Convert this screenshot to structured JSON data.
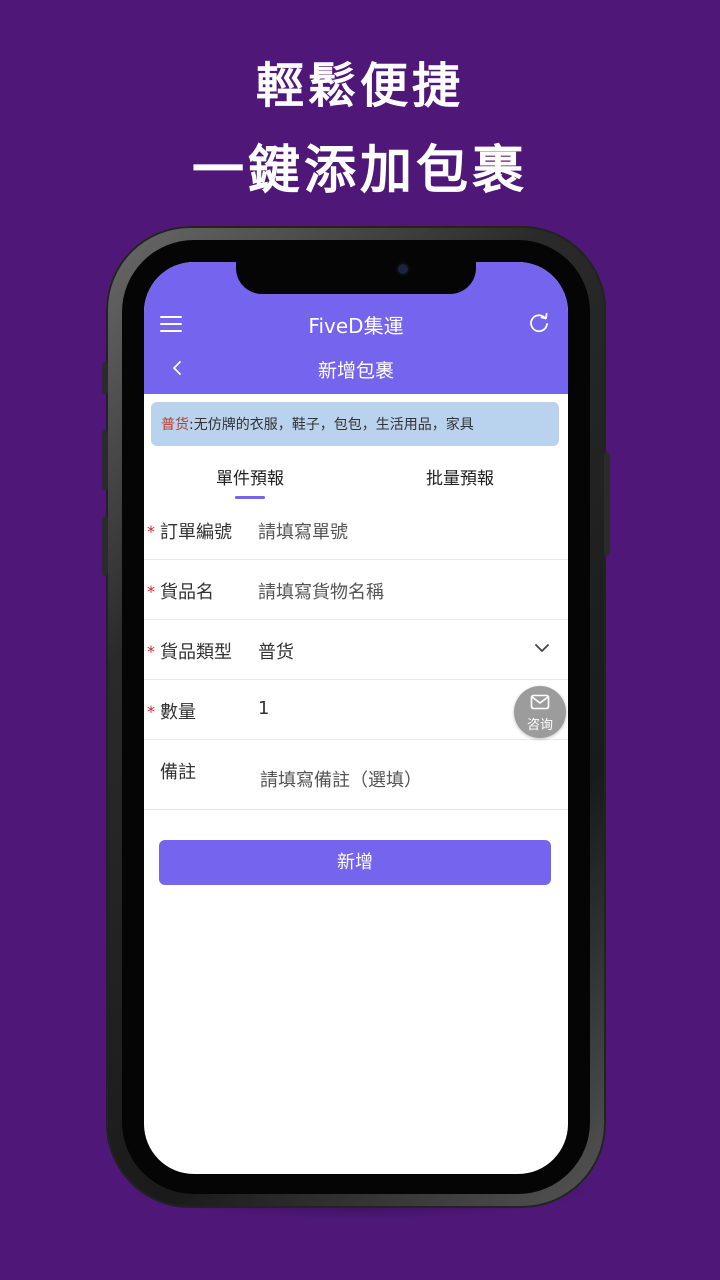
{
  "headline": {
    "line1": "輕鬆便捷",
    "line2": "一鍵添加包裹"
  },
  "app": {
    "title": "FiveD集運",
    "page_title": "新增包裹",
    "icons": [
      "menu-icon",
      "refresh-icon",
      "back-icon"
    ]
  },
  "notice": {
    "tag": "普货",
    "text": ":无仿牌的衣服，鞋子，包包，生活用品，家具"
  },
  "tabs": [
    {
      "label": "單件預報",
      "active": true
    },
    {
      "label": "批量預報",
      "active": false
    }
  ],
  "form": {
    "required_mark": "*",
    "order_no": {
      "label": "訂單編號",
      "placeholder": "請填寫單號"
    },
    "goods_name": {
      "label": "貨品名",
      "placeholder": "請填寫貨物名稱"
    },
    "goods_type": {
      "label": "貨品類型",
      "value": "普货"
    },
    "quantity": {
      "label": "數量",
      "value": "1"
    },
    "remark": {
      "label": "備註",
      "placeholder": "請填寫備註（選填）"
    }
  },
  "submit_label": "新增",
  "consult": {
    "label": "咨询",
    "icon": "mail-icon"
  },
  "colors": {
    "background": "#4f1878",
    "accent": "#7564ee",
    "notice_bg": "#b9d2ee",
    "required": "#d0242a"
  }
}
